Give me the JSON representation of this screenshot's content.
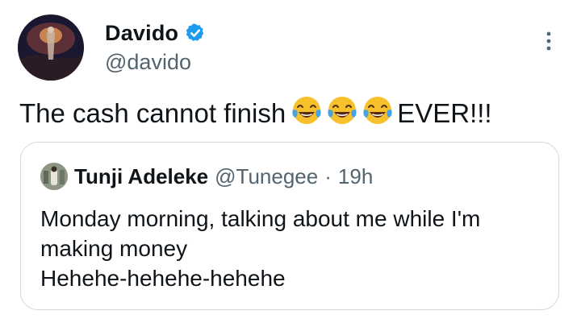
{
  "author": {
    "display_name": "Davido",
    "handle": "@davido",
    "verified": true,
    "avatar": "profile-photo"
  },
  "tweet": {
    "text_before": "The cash cannot finish",
    "emojis": [
      "face-with-tears-of-joy",
      "face-with-tears-of-joy",
      "face-with-tears-of-joy"
    ],
    "text_after": "EVER!!!"
  },
  "quoted": {
    "display_name": "Tunji Adeleke",
    "handle": "@Tunegee",
    "separator": "·",
    "time": "19h",
    "lines": [
      "Monday morning, talking about me while I'm",
      "making money",
      "Hehehe-hehehe-hehehe"
    ]
  },
  "colors": {
    "text": "#0f1419",
    "secondary": "#536471",
    "verified": "#1d9bf0",
    "border": "#cfd9de"
  }
}
